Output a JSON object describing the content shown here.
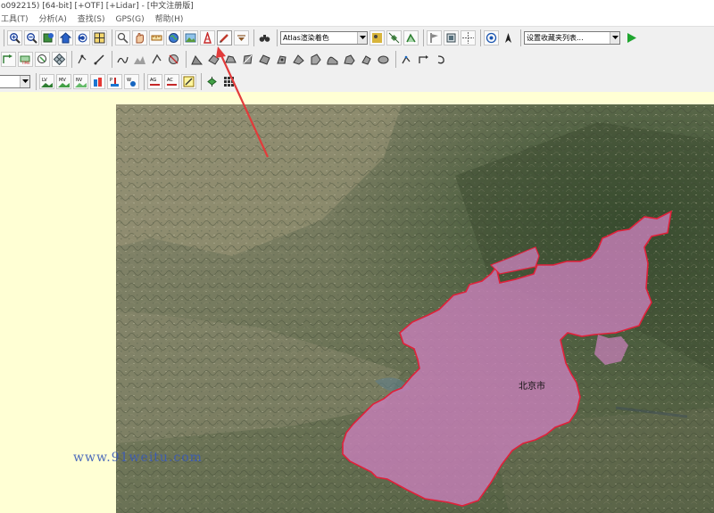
{
  "window": {
    "title": "o092215) [64-bit] [+OTF] [+Lidar] - [中文注册版]"
  },
  "menu": [
    "工具(T)",
    "分析(A)",
    "查找(S)",
    "GPS(G)",
    "帮助(H)"
  ],
  "toolbar": {
    "shader_select": "Atlas渲染着色",
    "favorites_select": "设置收藏夹列表..."
  },
  "map": {
    "region_label": "北京市",
    "watermark": "www.91weitu.com",
    "colors": {
      "region_fill": "#c77fb8",
      "region_border": "#e0213a",
      "pointer_arrow": "#e23b3b"
    }
  },
  "icons": {
    "toolbar1": [
      "zoom-in-icon",
      "zoom-out-icon",
      "zoom-layer-icon",
      "home-icon",
      "refresh-icon",
      "layout-icon",
      "find-icon",
      "pan-hand-icon",
      "measure-icon",
      "globe-icon",
      "map-image-icon",
      "tower-icon",
      "pencil-edit-icon",
      "dropdown-icon",
      "binoculars-icon",
      "layers-icon",
      "satellite-icon",
      "shade-icon",
      "flag-icon",
      "3d-icon",
      "crosshair-icon",
      "target-icon",
      "north-arrow-icon",
      "play-icon"
    ],
    "toolbar2": [
      "digitize-icon",
      "clip-icon",
      "select-icon",
      "grid-icon",
      "node-icon",
      "line-tool-icon",
      "path-icon",
      "terrain-icon",
      "vertex-icon",
      "circle-select-icon",
      "stamp-icon",
      "edit-area-icon",
      "combine-icon",
      "split-icon",
      "shape-icon",
      "move-icon",
      "rotate-icon",
      "scale-icon",
      "smooth-icon",
      "simplify-icon",
      "erase-icon",
      "cut-icon",
      "join-icon",
      "undo-arrow-icon"
    ],
    "toolbar3": [
      "lv-icon",
      "mv-icon",
      "nv-icon",
      "building-icon",
      "p-icon",
      "w-icon",
      "ag-icon",
      "ac-icon",
      "edit-icon",
      "network-icon",
      "grid-dots-icon"
    ]
  }
}
